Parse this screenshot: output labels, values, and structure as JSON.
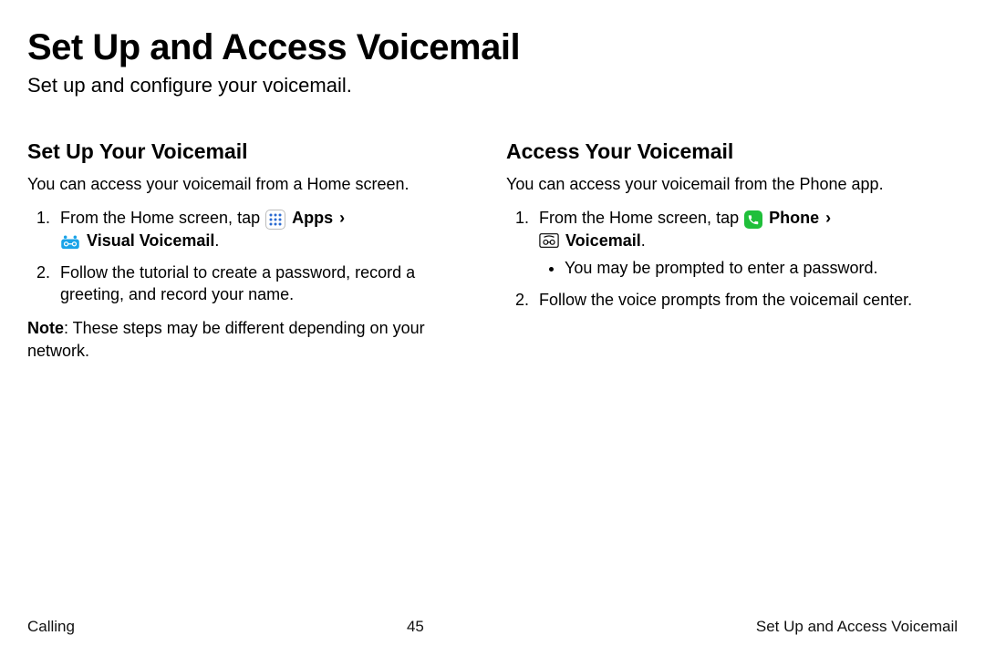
{
  "page": {
    "title": "Set Up and Access Voicemail",
    "subtitle": "Set up and configure your voicemail."
  },
  "left": {
    "heading": "Set Up Your Voicemail",
    "intro": "You can access your voicemail from a Home screen.",
    "step1_pre": "From the Home screen, tap ",
    "apps_label": "Apps",
    "chevron": "›",
    "vv_label": "Visual Voicemail",
    "step1_post": ".",
    "step2": "Follow the tutorial to create a password, record a greeting, and record your name.",
    "note_label": "Note",
    "note_rest": ": These steps may be different depending on your network."
  },
  "right": {
    "heading": "Access Your Voicemail",
    "intro": "You can access your voicemail from the Phone app.",
    "step1_pre": "From the Home screen, tap ",
    "phone_label": "Phone",
    "chevron": "›",
    "vm_label": "Voicemail",
    "step1_post": ".",
    "bullet1": "You may be prompted to enter a password.",
    "step2": "Follow the voice prompts from the voicemail center."
  },
  "footer": {
    "left": "Calling",
    "center": "45",
    "right": "Set Up and Access Voicemail"
  }
}
